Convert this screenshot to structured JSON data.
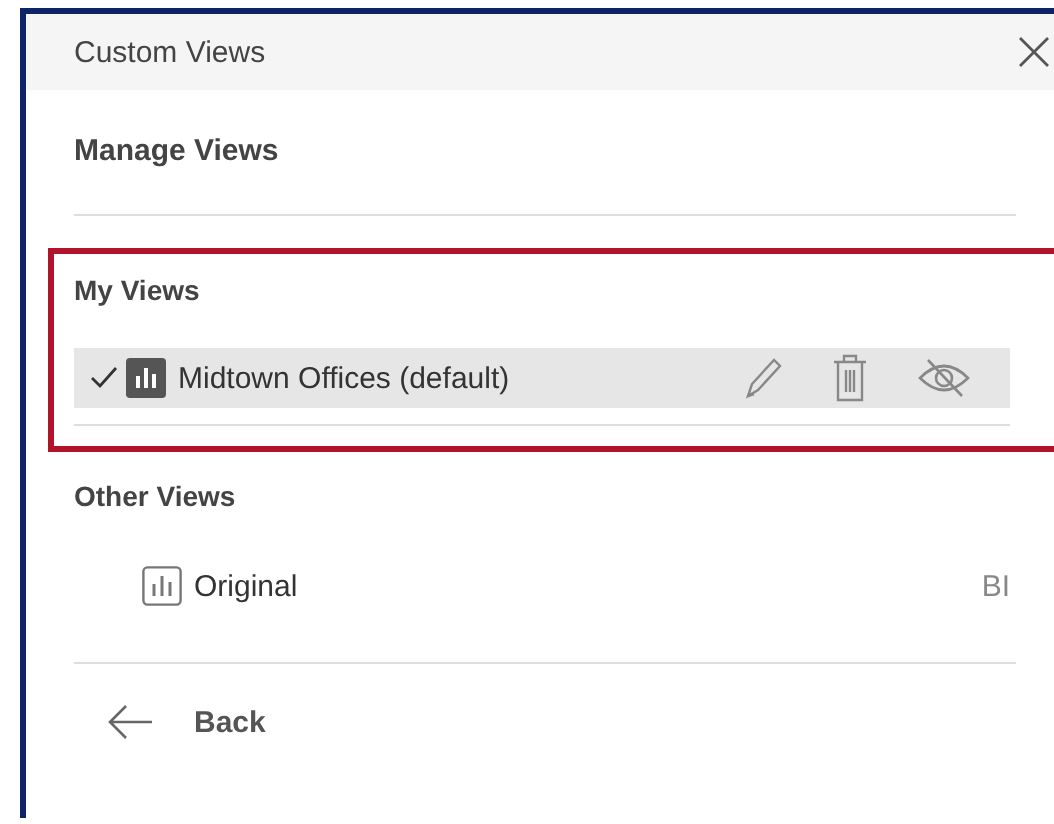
{
  "window": {
    "title": "Custom Views"
  },
  "heading": "Manage Views",
  "sections": [
    {
      "kind": "mine",
      "title": "My Views",
      "highlighted": true,
      "items": [
        {
          "label": "Midtown Offices (default)",
          "selected": true
        }
      ]
    },
    {
      "kind": "other",
      "title": "Other Views",
      "highlighted": false,
      "items": [
        {
          "label": "Original",
          "selected": false,
          "owner": "BI"
        }
      ]
    }
  ],
  "back": "Back"
}
